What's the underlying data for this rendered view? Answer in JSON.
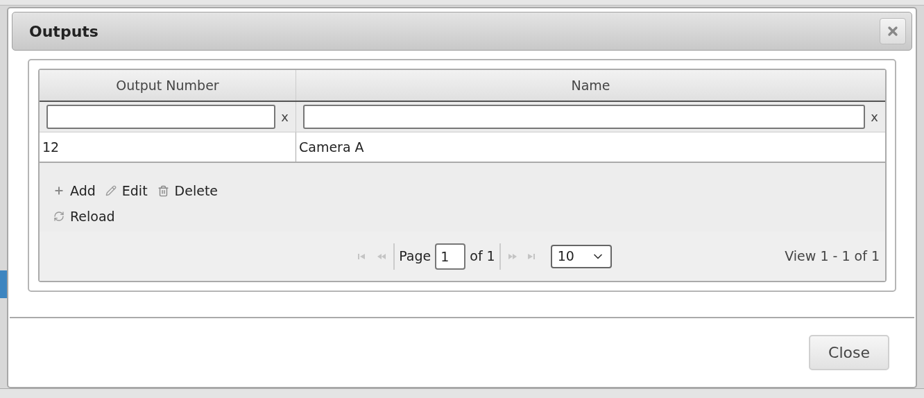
{
  "dialog": {
    "title": "Outputs"
  },
  "table": {
    "columns": [
      "Output Number",
      "Name"
    ],
    "filters": [
      {
        "clear": "x"
      },
      {
        "clear": "x"
      }
    ],
    "rows": [
      [
        "12",
        "Camera A"
      ]
    ]
  },
  "toolbar": [
    {
      "kind": "add",
      "label": "Add"
    },
    {
      "kind": "edit",
      "label": "Edit"
    },
    {
      "kind": "delete",
      "label": "Delete"
    },
    {
      "kind": "reload",
      "label": "Reload"
    }
  ],
  "pager": {
    "nav_before": [
      {
        "kind": "first",
        "disabled": true
      },
      {
        "kind": "prev",
        "disabled": true
      }
    ],
    "page_label": "Page",
    "page": "1",
    "of": "of 1",
    "nav_after": [
      {
        "kind": "next",
        "disabled": true
      },
      {
        "kind": "last",
        "disabled": true
      }
    ],
    "page_size": "10",
    "view": "View 1 - 1 of 1"
  },
  "footer": {
    "buttons": [
      "Close"
    ]
  }
}
